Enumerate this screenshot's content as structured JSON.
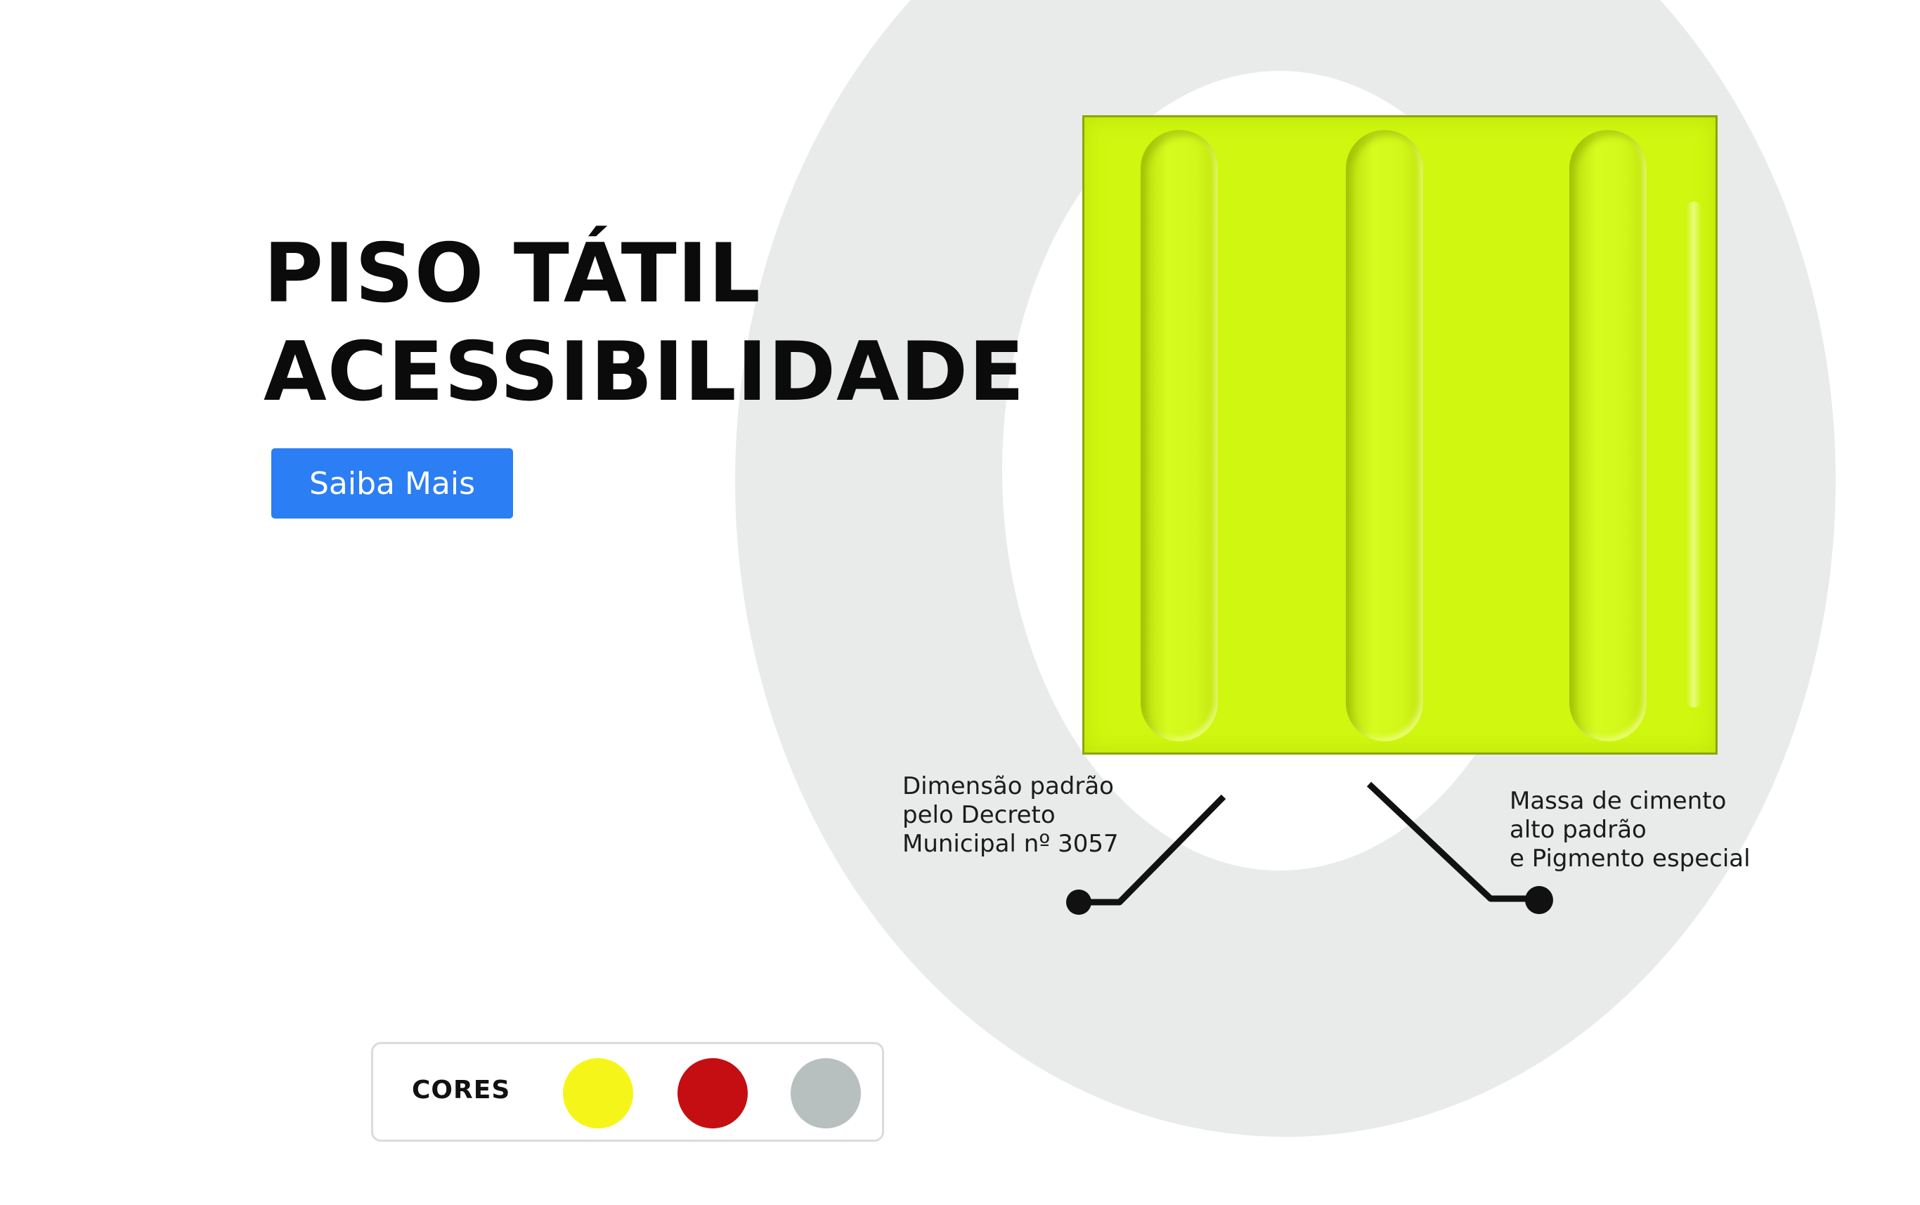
{
  "hero": {
    "title_lines": [
      "PISO TÁTIL",
      "ACESSIBILIDADE"
    ],
    "cta_label": "Saiba Mais"
  },
  "callouts": {
    "left_lines": [
      "Dimensão padrão",
      "pelo Decreto",
      "Municipal nº 3057"
    ],
    "right_lines": [
      "Massa de cimento",
      "alto padrão",
      "e Pigmento especial"
    ]
  },
  "colors": {
    "label": "CORES",
    "swatches": [
      {
        "name": "yellow",
        "hex": "#f6f51a"
      },
      {
        "name": "red",
        "hex": "#c40e12"
      },
      {
        "name": "gray",
        "hex": "#b7c0bf"
      }
    ]
  },
  "theme": {
    "accent": "#2b7ef3",
    "tile": "#cff70f",
    "ring": "#e8ebea"
  }
}
